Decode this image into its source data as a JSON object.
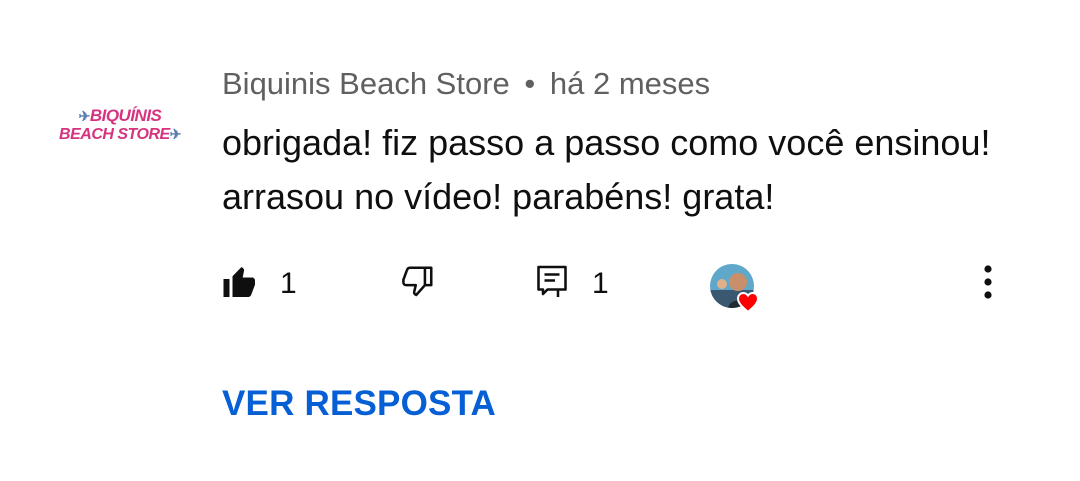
{
  "author": {
    "name": "Biquinis Beach Store",
    "separator": "•",
    "time": "há 2 meses",
    "avatar": {
      "line1": "BIQUÍNIS",
      "line2": "BEACH STORE"
    }
  },
  "comment": {
    "text": "obrigada! fiz passo a passo como você ensinou! arrasou no vídeo! parabéns! grata!"
  },
  "actions": {
    "like_count": "1",
    "reply_count": "1",
    "icons": [
      "thumbs-up-filled-icon",
      "thumbs-down-icon",
      "reply-comment-icon",
      "creator-heart-avatar",
      "more-vert-icon"
    ]
  },
  "reply_link": {
    "label": "VER RESPOSTA"
  },
  "colors": {
    "link": "#065fd4",
    "meta": "#606060",
    "text": "#0f0f0f",
    "heart": "#ff0000",
    "logo": "#d6337e"
  }
}
